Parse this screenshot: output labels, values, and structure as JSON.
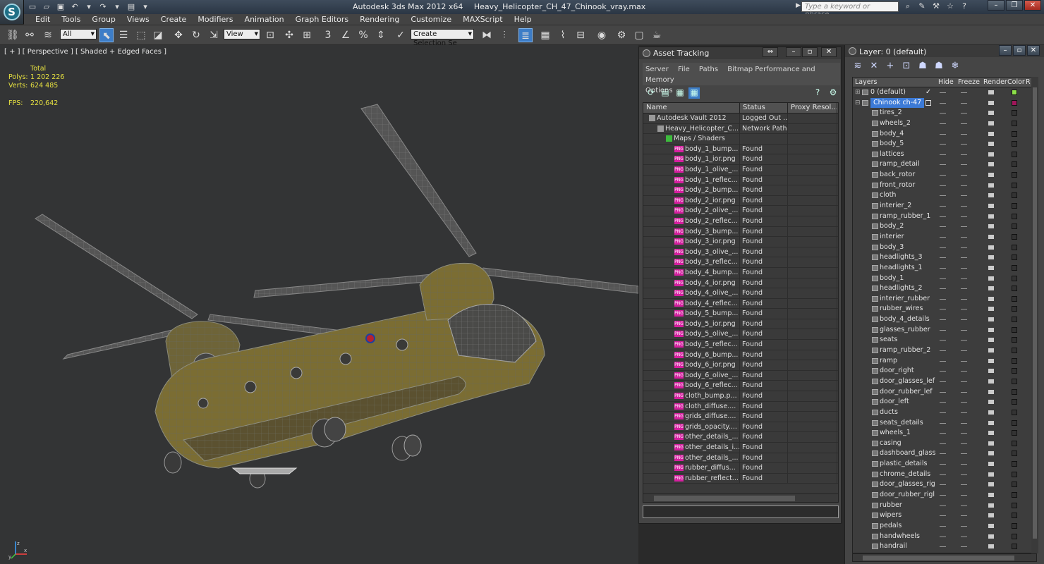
{
  "app": {
    "title_app": "Autodesk 3ds Max  2012 x64",
    "title_file": "Heavy_Helicopter_CH_47_Chinook_vray.max",
    "search_placeholder": "Type a keyword or phrase",
    "logo": "3ds-max-logo"
  },
  "menu": [
    "Edit",
    "Tools",
    "Group",
    "Views",
    "Create",
    "Modifiers",
    "Animation",
    "Graph Editors",
    "Rendering",
    "Customize",
    "MAXScript",
    "Help"
  ],
  "toolbar": {
    "filter_value": "All",
    "refcoord_value": "View",
    "selection_set": "Create Selection Se",
    "snap_label": "3"
  },
  "viewport": {
    "label": "[ + ] [ Perspective ] [ Shaded + Edged Faces ]",
    "stats_header": "Total",
    "polys_label": "Polys:",
    "polys_value": "1 202 226",
    "verts_label": "Verts:",
    "verts_value": "624 485",
    "fps_label": "FPS:",
    "fps_value": "220,642",
    "axis_x": "x",
    "axis_y": "y",
    "axis_z": "z"
  },
  "asset_tracking": {
    "title": "Asset Tracking",
    "menu": [
      "Server",
      "File",
      "Paths",
      "Bitmap Performance and Memory",
      "Options"
    ],
    "columns": [
      "Name",
      "Status",
      "Proxy Resol..."
    ],
    "rows": [
      {
        "indent": 1,
        "icon": "vault",
        "name": "Autodesk Vault 2012",
        "status": "Logged Out ..."
      },
      {
        "indent": 2,
        "icon": "file",
        "name": "Heavy_Helicopter_C...",
        "status": "Network Path"
      },
      {
        "indent": 3,
        "icon": "maps",
        "name": "Maps / Shaders",
        "status": ""
      },
      {
        "indent": 4,
        "icon": "png",
        "name": "body_1_bump...",
        "status": "Found"
      },
      {
        "indent": 4,
        "icon": "png",
        "name": "body_1_ior.png",
        "status": "Found"
      },
      {
        "indent": 4,
        "icon": "png",
        "name": "body_1_olive_...",
        "status": "Found"
      },
      {
        "indent": 4,
        "icon": "png",
        "name": "body_1_reflec...",
        "status": "Found"
      },
      {
        "indent": 4,
        "icon": "png",
        "name": "body_2_bump...",
        "status": "Found"
      },
      {
        "indent": 4,
        "icon": "png",
        "name": "body_2_ior.png",
        "status": "Found"
      },
      {
        "indent": 4,
        "icon": "png",
        "name": "body_2_olive_...",
        "status": "Found"
      },
      {
        "indent": 4,
        "icon": "png",
        "name": "body_2_reflec...",
        "status": "Found"
      },
      {
        "indent": 4,
        "icon": "png",
        "name": "body_3_bump...",
        "status": "Found"
      },
      {
        "indent": 4,
        "icon": "png",
        "name": "body_3_ior.png",
        "status": "Found"
      },
      {
        "indent": 4,
        "icon": "png",
        "name": "body_3_olive_...",
        "status": "Found"
      },
      {
        "indent": 4,
        "icon": "png",
        "name": "body_3_reflec...",
        "status": "Found"
      },
      {
        "indent": 4,
        "icon": "png",
        "name": "body_4_bump...",
        "status": "Found"
      },
      {
        "indent": 4,
        "icon": "png",
        "name": "body_4_ior.png",
        "status": "Found"
      },
      {
        "indent": 4,
        "icon": "png",
        "name": "body_4_olive_...",
        "status": "Found"
      },
      {
        "indent": 4,
        "icon": "png",
        "name": "body_4_reflec...",
        "status": "Found"
      },
      {
        "indent": 4,
        "icon": "png",
        "name": "body_5_bump...",
        "status": "Found"
      },
      {
        "indent": 4,
        "icon": "png",
        "name": "body_5_ior.png",
        "status": "Found"
      },
      {
        "indent": 4,
        "icon": "png",
        "name": "body_5_olive_...",
        "status": "Found"
      },
      {
        "indent": 4,
        "icon": "png",
        "name": "body_5_reflec...",
        "status": "Found"
      },
      {
        "indent": 4,
        "icon": "png",
        "name": "body_6_bump...",
        "status": "Found"
      },
      {
        "indent": 4,
        "icon": "png",
        "name": "body_6_ior.png",
        "status": "Found"
      },
      {
        "indent": 4,
        "icon": "png",
        "name": "body_6_olive_...",
        "status": "Found"
      },
      {
        "indent": 4,
        "icon": "png",
        "name": "body_6_reflec...",
        "status": "Found"
      },
      {
        "indent": 4,
        "icon": "png",
        "name": "cloth_bump.p...",
        "status": "Found"
      },
      {
        "indent": 4,
        "icon": "png",
        "name": "cloth_diffuse....",
        "status": "Found"
      },
      {
        "indent": 4,
        "icon": "png",
        "name": "grids_diffuse....",
        "status": "Found"
      },
      {
        "indent": 4,
        "icon": "png",
        "name": "grids_opacity....",
        "status": "Found"
      },
      {
        "indent": 4,
        "icon": "png",
        "name": "other_details_...",
        "status": "Found"
      },
      {
        "indent": 4,
        "icon": "png",
        "name": "other_details_i...",
        "status": "Found"
      },
      {
        "indent": 4,
        "icon": "png",
        "name": "other_details_...",
        "status": "Found"
      },
      {
        "indent": 4,
        "icon": "png",
        "name": "rubber_diffus...",
        "status": "Found"
      },
      {
        "indent": 4,
        "icon": "png",
        "name": "rubber_reflect...",
        "status": "Found"
      }
    ]
  },
  "layer_panel": {
    "title": "Layer: 0 (default)",
    "columns": [
      "Layers",
      "Hide",
      "Freeze",
      "Render",
      "Color",
      "R"
    ],
    "default_layer": "0 (default)",
    "selected_layer": "Chinook ch-47",
    "default_color": "#8de04a",
    "selected_color": "#a0165a",
    "children": [
      "tires_2",
      "wheels_2",
      "body_4",
      "body_5",
      "lattices",
      "ramp_detail",
      "back_rotor",
      "front_rotor",
      "cloth",
      "interier_2",
      "ramp_rubber_1",
      "body_2",
      "interier",
      "body_3",
      "headlights_3",
      "headlights_1",
      "body_1",
      "headlights_2",
      "interier_rubber",
      "rubber_wires",
      "body_4_details",
      "glasses_rubber",
      "seats",
      "ramp_rubber_2",
      "ramp",
      "door_right",
      "door_glasses_lef",
      "door_rubber_lef",
      "door_left",
      "ducts",
      "seats_details",
      "wheels_1",
      "casing",
      "dashboard_glass",
      "plastic_details",
      "chrome_details",
      "door_glasses_rig",
      "door_rubber_rigl",
      "rubber",
      "wipers",
      "pedals",
      "handwheels",
      "handrail"
    ]
  },
  "colors": {
    "accent": "#3c7ad6",
    "stats_text": "#e6e040",
    "png_badge": "#d61fa0"
  }
}
